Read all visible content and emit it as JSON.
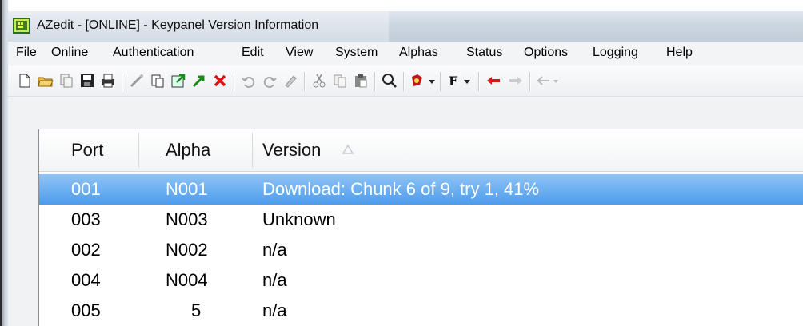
{
  "window": {
    "title": "AZedit - [ONLINE] - Keypanel Version Information"
  },
  "menu": [
    "File",
    "Online",
    "Authentication",
    "Edit",
    "View",
    "System",
    "Alphas",
    "Status",
    "Options",
    "Logging",
    "Help"
  ],
  "toolbar_icons": [
    "new-file-icon",
    "open-folder-icon",
    "copy-doc-icon",
    "save-icon",
    "print-icon",
    "wand-icon",
    "paste-icon",
    "export-icon",
    "arrow-icon",
    "delete-icon",
    "undo-icon",
    "redo-icon",
    "eraser-icon",
    "cut-icon",
    "copy-icon",
    "paste-board-icon",
    "find-icon",
    "tools-dropdown-icon",
    "font-dropdown-icon",
    "back-arrow-icon",
    "forward-arrow-icon",
    "network-icon"
  ],
  "table": {
    "columns": [
      "Port",
      "Alpha",
      "Version"
    ],
    "sort_column": "Version",
    "rows": [
      {
        "port": "001",
        "alpha": "N001",
        "version": "Download: Chunk 6 of 9, try 1,  41%",
        "selected": true
      },
      {
        "port": "003",
        "alpha": "N003",
        "version": "Unknown",
        "selected": false
      },
      {
        "port": "002",
        "alpha": "N002",
        "version": "n/a",
        "selected": false
      },
      {
        "port": "004",
        "alpha": "N004",
        "version": "n/a",
        "selected": false
      },
      {
        "port": "005",
        "alpha": "5",
        "version": "n/a",
        "selected": false
      }
    ]
  },
  "colors": {
    "selection": "#4d9cec",
    "menubar": "#f3f4f6",
    "titlebar": "#ccd6e0"
  }
}
